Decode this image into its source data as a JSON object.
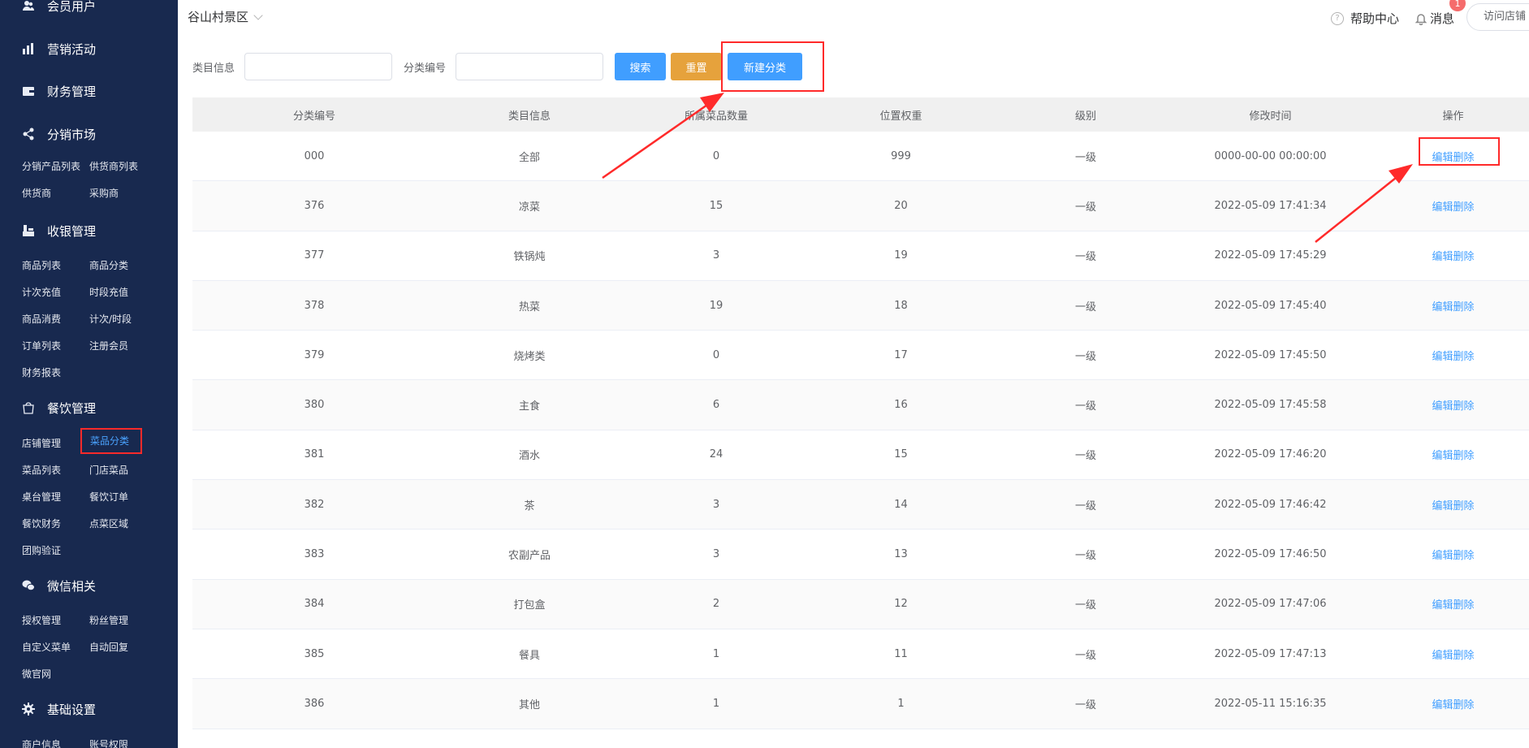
{
  "sidebar": {
    "sections": [
      {
        "title": "会员用户",
        "icon": "users-icon"
      },
      {
        "title": "营销活动",
        "icon": "chart-bars-icon"
      },
      {
        "title": "财务管理",
        "icon": "wallet-icon"
      },
      {
        "title": "分销市场",
        "icon": "share-nodes-icon"
      },
      {
        "title": "收银管理",
        "icon": "cashier-icon"
      },
      {
        "title": "餐饮管理",
        "icon": "shopping-bag-icon"
      },
      {
        "title": "微信相关",
        "icon": "wechat-icon"
      },
      {
        "title": "基础设置",
        "icon": "gear-icon"
      }
    ],
    "items": {
      "fenxiao": [
        "分销产品列表",
        "供货商列表",
        "供货商",
        "采购商"
      ],
      "shouyin": [
        "商品列表",
        "商品分类",
        "计次充值",
        "时段充值",
        "商品消费",
        "计次/时段",
        "订单列表",
        "注册会员",
        "财务报表"
      ],
      "canyin": [
        "店铺管理",
        "菜品分类",
        "菜品列表",
        "门店菜品",
        "桌台管理",
        "餐饮订单",
        "餐饮财务",
        "点菜区域",
        "团购验证"
      ],
      "weixin": [
        "授权管理",
        "粉丝管理",
        "自定义菜单",
        "自动回复",
        "微官网"
      ],
      "jichu": [
        "商户信息",
        "账号权限"
      ]
    }
  },
  "header": {
    "store_name": "谷山村景区",
    "help": "帮助中心",
    "messages": "消息",
    "badge": "1",
    "visit": "访问店铺"
  },
  "filters": {
    "label1": "类目信息",
    "label2": "分类编号",
    "input1_value": "",
    "input2_value": "",
    "search": "搜索",
    "reset": "重置",
    "create": "新建分类"
  },
  "table": {
    "headers": [
      "分类编号",
      "类目信息",
      "所属菜品数量",
      "位置权重",
      "级别",
      "修改时间",
      "操作"
    ],
    "rows": [
      [
        "000",
        "全部",
        "0",
        "999",
        "一级",
        "0000-00-00 00:00:00",
        "编辑删除"
      ],
      [
        "376",
        "凉菜",
        "15",
        "20",
        "一级",
        "2022-05-09 17:41:34",
        "编辑删除"
      ],
      [
        "377",
        "铁锅炖",
        "3",
        "19",
        "一级",
        "2022-05-09 17:45:29",
        "编辑删除"
      ],
      [
        "378",
        "热菜",
        "19",
        "18",
        "一级",
        "2022-05-09 17:45:40",
        "编辑删除"
      ],
      [
        "379",
        "烧烤类",
        "0",
        "17",
        "一级",
        "2022-05-09 17:45:50",
        "编辑删除"
      ],
      [
        "380",
        "主食",
        "6",
        "16",
        "一级",
        "2022-05-09 17:45:58",
        "编辑删除"
      ],
      [
        "381",
        "酒水",
        "24",
        "15",
        "一级",
        "2022-05-09 17:46:20",
        "编辑删除"
      ],
      [
        "382",
        "茶",
        "3",
        "14",
        "一级",
        "2022-05-09 17:46:42",
        "编辑删除"
      ],
      [
        "383",
        "农副产品",
        "3",
        "13",
        "一级",
        "2022-05-09 17:46:50",
        "编辑删除"
      ],
      [
        "384",
        "打包盒",
        "2",
        "12",
        "一级",
        "2022-05-09 17:47:06",
        "编辑删除"
      ],
      [
        "385",
        "餐具",
        "1",
        "11",
        "一级",
        "2022-05-09 17:47:13",
        "编辑删除"
      ],
      [
        "386",
        "其他",
        "1",
        "1",
        "一级",
        "2022-05-11 15:16:35",
        "编辑删除"
      ]
    ]
  },
  "colors": {
    "sidebar_bg": "#18294f",
    "primary": "#409eff",
    "warning": "#e6a23c",
    "annotation": "#ff2a2a"
  }
}
